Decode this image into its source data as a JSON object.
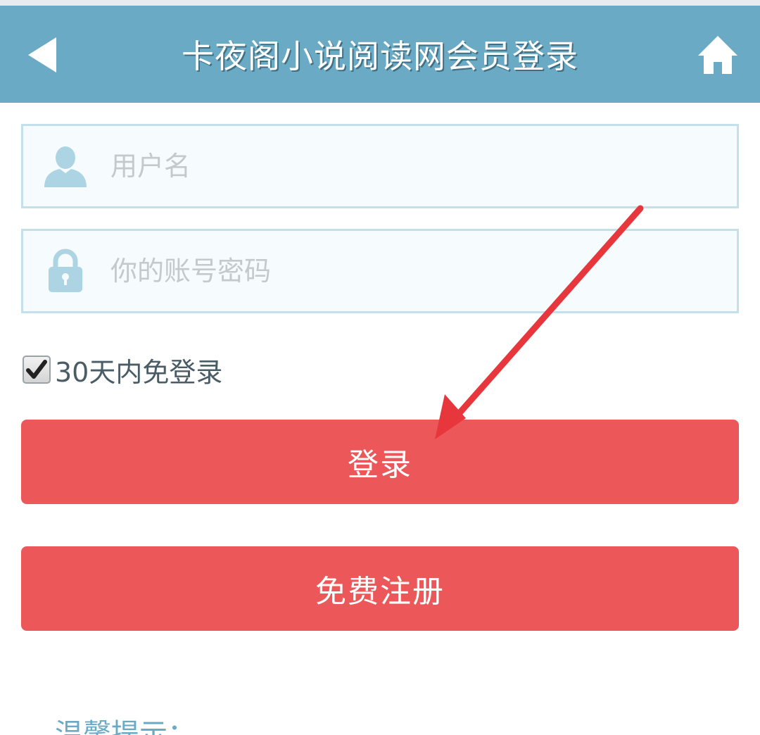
{
  "header": {
    "title": "卡夜阁小说阅读网会员登录",
    "back_icon": "back-arrow-icon",
    "home_icon": "home-icon",
    "background": "#6aaac4"
  },
  "form": {
    "username": {
      "placeholder": "用户名",
      "value": "",
      "icon": "user-icon"
    },
    "password": {
      "placeholder": "你的账号密码",
      "value": "",
      "icon": "lock-icon"
    },
    "remember": {
      "label": "30天内免登录",
      "checked": true
    }
  },
  "buttons": {
    "login_label": "登录",
    "register_label": "免费注册",
    "color": "#ec5859"
  },
  "tips": {
    "title": "温馨提示："
  },
  "annotation": {
    "arrow_color": "#e8373c",
    "arrow_icon": "red-arrow-annotation"
  }
}
